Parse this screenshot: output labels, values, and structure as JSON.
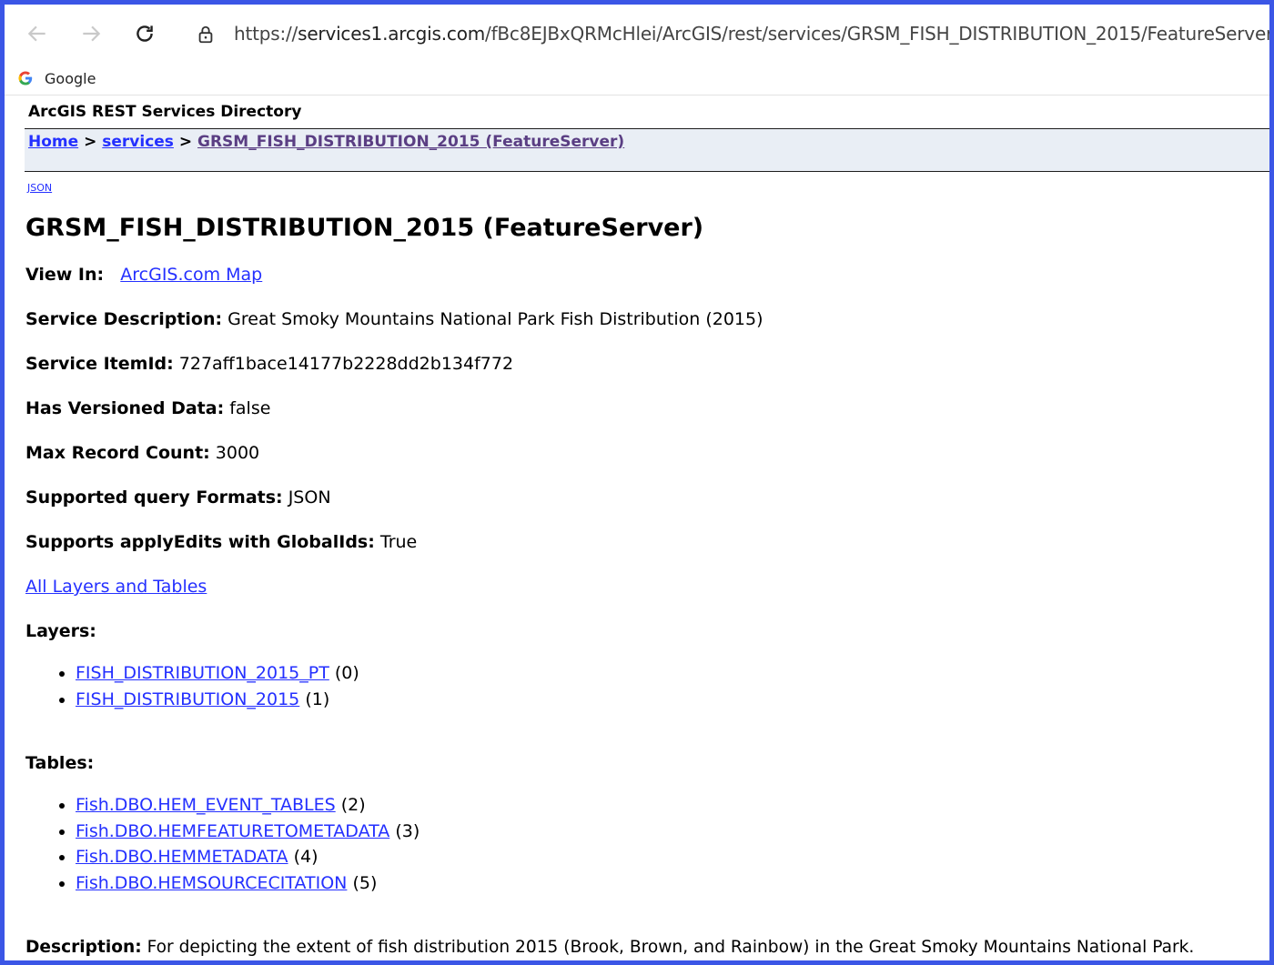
{
  "browser": {
    "url_scheme": "https://",
    "url_host": "services1.arcgis.com",
    "url_path": "/fBc8EJBxQRMcHlei/ArcGIS/rest/services/GRSM_FISH_DISTRIBUTION_2015/FeatureServer",
    "back_icon": "arrow-left-icon",
    "forward_icon": "arrow-right-icon",
    "reload_icon": "reload-icon",
    "lock_icon": "lock-icon"
  },
  "bookmarks": [
    {
      "label": "Google",
      "icon": "google-icon"
    }
  ],
  "directory": {
    "title": "ArcGIS REST Services Directory",
    "breadcrumb": {
      "home": "Home",
      "sep1": " > ",
      "services": "services",
      "sep2": " > ",
      "current": "GRSM_FISH_DISTRIBUTION_2015 (FeatureServer)"
    },
    "json_link": "JSON"
  },
  "service": {
    "title": "GRSM_FISH_DISTRIBUTION_2015 (FeatureServer)",
    "view_in_label": "View In:",
    "view_in_link": "ArcGIS.com Map",
    "description_label": "Service Description:",
    "description_value": "Great Smoky Mountains National Park Fish Distribution (2015)",
    "itemid_label": "Service ItemId:",
    "itemid_value": "727aff1bace14177b2228dd2b134f772",
    "versioned_label": "Has Versioned Data:",
    "versioned_value": "false",
    "max_record_label": "Max Record Count:",
    "max_record_value": "3000",
    "query_formats_label": "Supported query Formats:",
    "query_formats_value": "JSON",
    "apply_edits_label": "Supports applyEdits with GlobalIds:",
    "apply_edits_value": "True",
    "all_layers_link": "All Layers and Tables",
    "layers_label": "Layers:",
    "layers": [
      {
        "name": "FISH_DISTRIBUTION_2015_PT",
        "id": "(0)"
      },
      {
        "name": "FISH_DISTRIBUTION_2015",
        "id": "(1)"
      }
    ],
    "tables_label": "Tables:",
    "tables": [
      {
        "name": "Fish.DBO.HEM_EVENT_TABLES",
        "id": "(2)"
      },
      {
        "name": "Fish.DBO.HEMFEATURETOMETADATA",
        "id": "(3)"
      },
      {
        "name": "Fish.DBO.HEMMETADATA",
        "id": "(4)"
      },
      {
        "name": "Fish.DBO.HEMSOURCECITATION",
        "id": "(5)"
      }
    ],
    "long_description_label": "Description:",
    "long_description_value": "For depicting the extent of fish distribution 2015 (Brook, Brown, and Rainbow) in the Great Smoky Mountains National Park."
  },
  "colors": {
    "link": "#2430ff",
    "visited_link": "#5a3e83",
    "nav_bg": "#e9eef5",
    "frame": "#3b56e6"
  }
}
